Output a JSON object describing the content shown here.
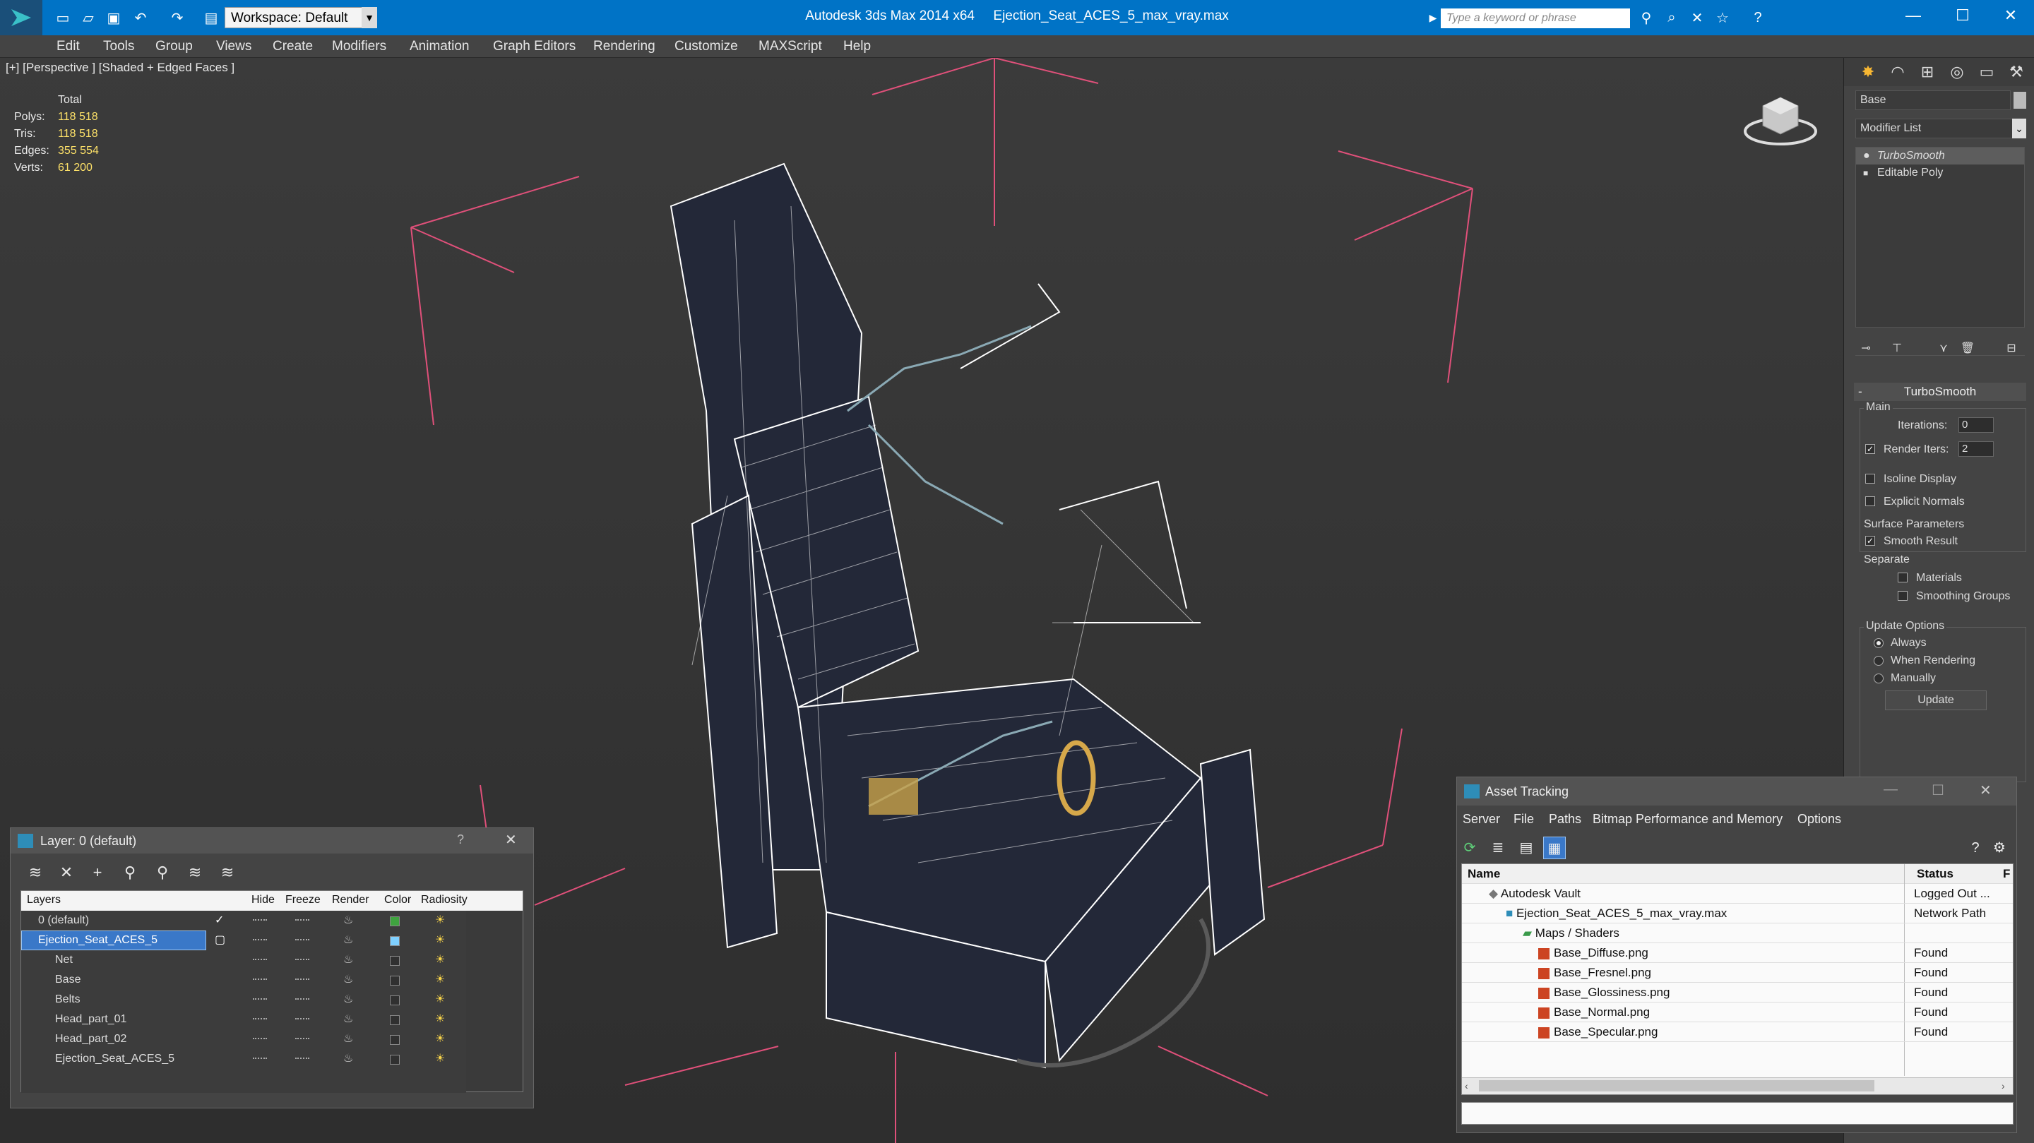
{
  "titlebar": {
    "app_title": "Autodesk 3ds Max  2014 x64",
    "file_title": "Ejection_Seat_ACES_5_max_vray.max",
    "workspace": "Workspace: Default",
    "search_placeholder": "Type a keyword or phrase"
  },
  "menu": [
    "Edit",
    "Tools",
    "Group",
    "Views",
    "Create",
    "Modifiers",
    "Animation",
    "Graph Editors",
    "Rendering",
    "Customize",
    "MAXScript",
    "Help"
  ],
  "viewport": {
    "label": "[+] [Perspective ] [Shaded + Edged Faces ]",
    "stats_header": "Total",
    "stats": [
      {
        "label": "Polys:",
        "value": "118 518"
      },
      {
        "label": "Tris:",
        "value": "118 518"
      },
      {
        "label": "Edges:",
        "value": "355 554"
      },
      {
        "label": "Verts:",
        "value": "61 200"
      }
    ]
  },
  "command_panel": {
    "object_name": "Base",
    "modifier_list": "Modifier List",
    "stack": [
      "TurboSmooth",
      "Editable Poly"
    ],
    "rollout_title": "TurboSmooth",
    "main_group": "Main",
    "iterations_label": "Iterations:",
    "iterations_value": "0",
    "render_iters_label": "Render Iters:",
    "render_iters_value": "2",
    "isoline_label": "Isoline Display",
    "explicit_normals_label": "Explicit Normals",
    "surface_group": "Surface Parameters",
    "smooth_result_label": "Smooth Result",
    "separate_label": "Separate",
    "materials_label": "Materials",
    "smoothing_groups_label": "Smoothing Groups",
    "update_group": "Update Options",
    "always_label": "Always",
    "when_rendering_label": "When Rendering",
    "manually_label": "Manually",
    "update_button": "Update"
  },
  "layer_window": {
    "title": "Layer: 0 (default)",
    "help": "?",
    "columns": [
      "Layers",
      "Hide",
      "Freeze",
      "Render",
      "Color",
      "Radiosity"
    ],
    "rows": [
      {
        "name": "0 (default)",
        "color": "#3fa33f"
      },
      {
        "name": "Ejection_Seat_ACES_5",
        "color": "#7fd0ff"
      },
      {
        "name": "Net",
        "color": "#303030"
      },
      {
        "name": "Base",
        "color": "#303030"
      },
      {
        "name": "Belts",
        "color": "#303030"
      },
      {
        "name": "Head_part_01",
        "color": "#303030"
      },
      {
        "name": "Head_part_02",
        "color": "#303030"
      },
      {
        "name": "Ejection_Seat_ACES_5",
        "color": "#303030"
      }
    ]
  },
  "asset_window": {
    "title": "Asset Tracking",
    "menu": [
      "Server",
      "File",
      "Paths",
      "Bitmap Performance and Memory",
      "Options"
    ],
    "col_name": "Name",
    "col_status": "Status",
    "col_extra": "F",
    "rows": [
      {
        "name": "Autodesk Vault",
        "status": "Logged Out ..."
      },
      {
        "name": "Ejection_Seat_ACES_5_max_vray.max",
        "status": "Network Path"
      },
      {
        "name": "Maps / Shaders",
        "status": ""
      },
      {
        "name": "Base_Diffuse.png",
        "status": "Found"
      },
      {
        "name": "Base_Fresnel.png",
        "status": "Found"
      },
      {
        "name": "Base_Glossiness.png",
        "status": "Found"
      },
      {
        "name": "Base_Normal.png",
        "status": "Found"
      },
      {
        "name": "Base_Specular.png",
        "status": "Found"
      }
    ]
  },
  "colors": {
    "titlebar": "#0073c6",
    "selection": "#3a78c8",
    "stats_value": "#fce068",
    "wire": "#ffffff",
    "gizmo": "#e0507a"
  }
}
